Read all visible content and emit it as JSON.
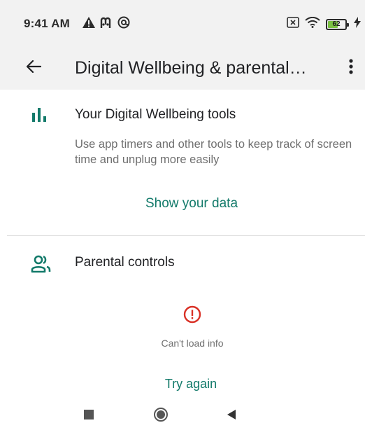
{
  "status_bar": {
    "time": "9:41 AM",
    "battery_level": "62",
    "battery_percent": 62,
    "icons": [
      "warning-triangle-icon",
      "m-logo-icon",
      "at-circle-icon",
      "sim-off-icon",
      "wifi-icon",
      "battery-icon",
      "charging-bolt-icon"
    ]
  },
  "app_bar": {
    "title": "Digital Wellbeing & parental…",
    "back_icon": "arrow-left-icon",
    "more_icon": "more-vertical-icon"
  },
  "wellbeing": {
    "icon": "bar-chart-icon",
    "title": "Your Digital Wellbeing tools",
    "description": "Use app timers and other tools to keep track of screen time and unplug more easily",
    "action_label": "Show your data"
  },
  "parental": {
    "icon": "people-icon",
    "title": "Parental controls",
    "error_icon": "error-circle-icon",
    "error_text": "Can't load info",
    "retry_label": "Try again"
  },
  "nav_bar": {
    "icons": [
      "recents-square-icon",
      "home-circle-icon",
      "back-triangle-icon"
    ]
  },
  "colors": {
    "accent": "#137a6a",
    "error": "#d93025",
    "battery_fill": "#7bc043",
    "background": "#f2f2f2",
    "card": "#ffffff"
  }
}
